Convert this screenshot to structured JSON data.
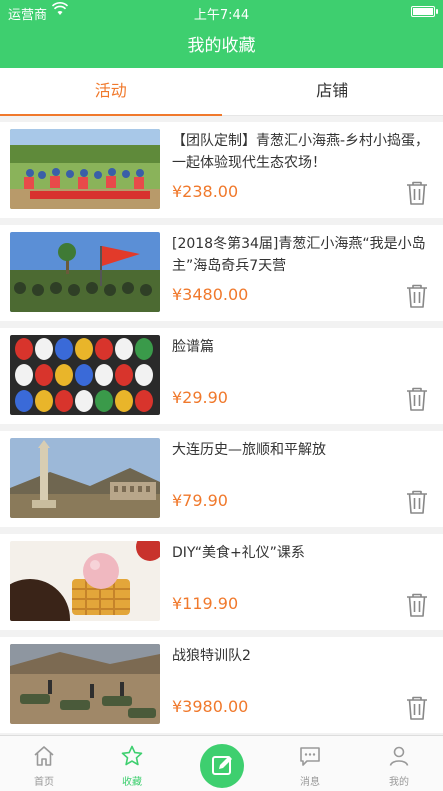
{
  "status": {
    "carrier": "运营商",
    "time": "上午7:44",
    "battery_level": 1.0
  },
  "header": {
    "title": "我的收藏"
  },
  "tabs": [
    {
      "label": "活动",
      "active": true
    },
    {
      "label": "店铺",
      "active": false
    }
  ],
  "items": [
    {
      "title": "【团队定制】青葱汇小海燕-乡村小捣蛋，一起体验现代生态农场！",
      "price": "¥238.00"
    },
    {
      "title": "[2018冬第34届]青葱汇小海燕“我是小岛主”海岛奇兵7天营",
      "price": "¥3480.00"
    },
    {
      "title": "脸谱篇",
      "price": "¥29.90"
    },
    {
      "title": "大连历史—旅顺和平解放",
      "price": "¥79.90"
    },
    {
      "title": "DIY“美食+礼仪”课系",
      "price": "¥119.90"
    },
    {
      "title": "战狼特训队2",
      "price": "¥3980.00"
    }
  ],
  "tabbar": {
    "home": "首页",
    "favorites": "收藏",
    "messages": "消息",
    "mine": "我的"
  },
  "colors": {
    "brand": "#3ecf6f",
    "accent": "#f0792c"
  }
}
